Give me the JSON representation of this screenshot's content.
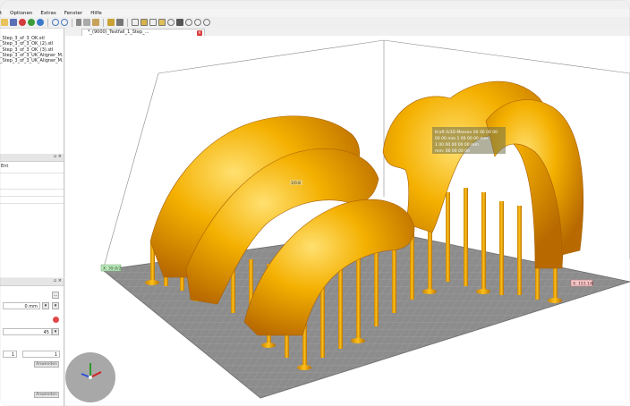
{
  "menu": [
    "t",
    "Optionen",
    "Extras",
    "Fenster",
    "Hilfe"
  ],
  "files": [
    "_Step_3_of_3_OK.stl",
    "_Step_3_of_3_OK_(2).stl",
    "_Step_3_of_3_OK_(3).stl",
    "_Step_3_of_3_UK_Aligner_M...",
    "_Step_3_of_3_UK_Aligner_M..."
  ],
  "props_panel": {
    "rows": [
      "Ent",
      "",
      "",
      ""
    ]
  },
  "settings_panel": {
    "field1_value": "0 mm",
    "field2_value": "45",
    "field3_value": "1",
    "field4_value": "1",
    "apply_label": "Anwenden",
    "apply_label_2": "Anwenden"
  },
  "tab": {
    "label": "*_(9000)_Testfall_1_Step_..."
  },
  "viewport": {
    "tooltip_lines": [
      "Kraft 0/3D Messen 00 00 00 00",
      "00 00 mm 1 00 00 00 mm",
      "1 00 00 00 00 00 mm",
      "mm: 00 00 00 00"
    ],
    "label_left": "X: 39.8/2",
    "label_right": "X: 153.1/6",
    "label_center": "1/0.8",
    "colors": {
      "resin": "#f0a000",
      "plate": "#8c8c8c",
      "grid": "#bdbdbd"
    }
  },
  "icons": {
    "toolbar": [
      "folder-icon",
      "save-icon",
      "delete-icon",
      "add-icon",
      "layers-icon",
      "undo-icon",
      "redo-icon",
      "cut-icon",
      "copy-icon",
      "paste-icon",
      "grid-icon",
      "support-icon",
      "view-iso-icon",
      "view-front-icon",
      "view-side-icon",
      "view-top-icon",
      "rotate-icon",
      "camera-icon",
      "zoom-fit-icon",
      "zoom-in-icon",
      "zoom-out-icon"
    ]
  }
}
